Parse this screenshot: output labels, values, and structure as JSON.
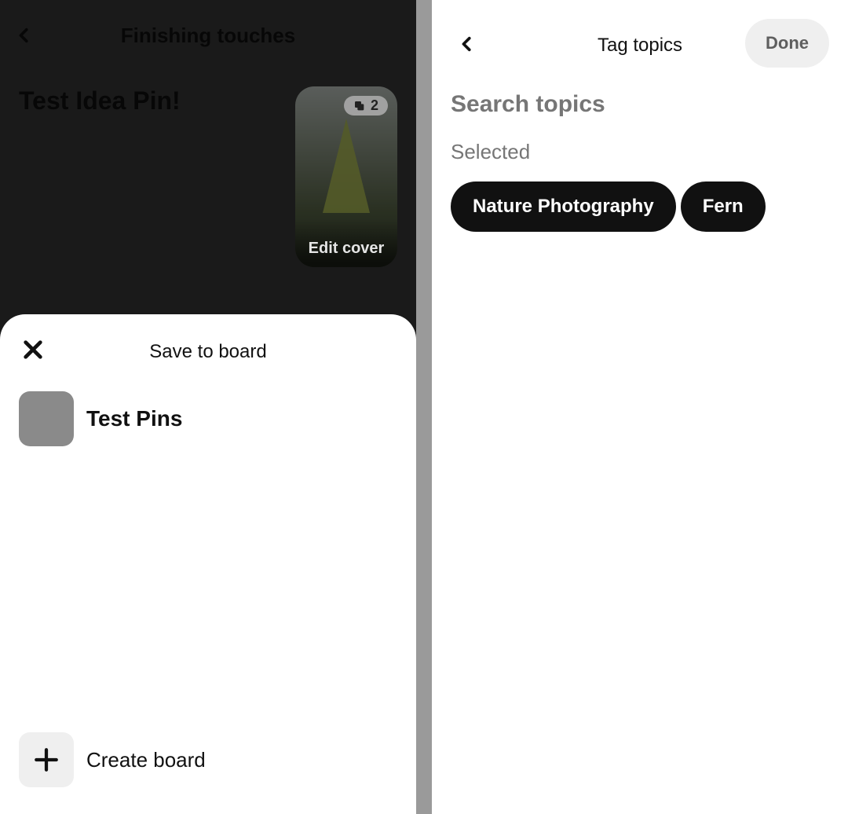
{
  "left": {
    "header_title": "Finishing touches",
    "pin_title": "Test Idea Pin!",
    "page_count": "2",
    "edit_cover_label": "Edit cover"
  },
  "sheet": {
    "title": "Save to board",
    "boards": [
      {
        "name": "Test Pins"
      }
    ],
    "create_label": "Create board"
  },
  "right": {
    "title": "Tag topics",
    "done_label": "Done",
    "search_placeholder": "Search topics",
    "selected_label": "Selected",
    "selected_topics": [
      "Nature Photography",
      "Fern"
    ]
  }
}
